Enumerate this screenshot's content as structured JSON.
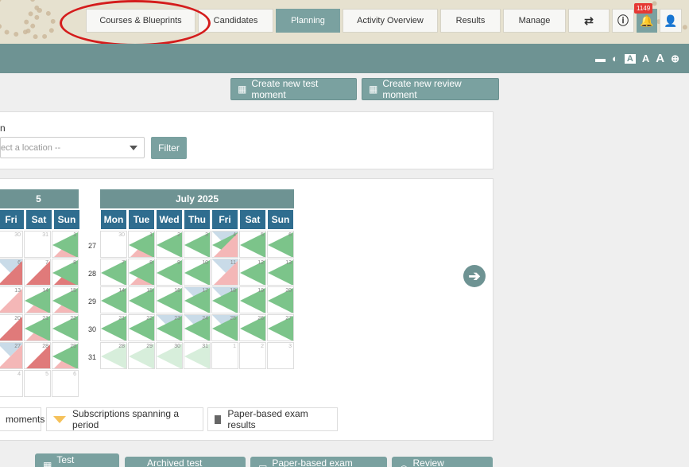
{
  "nav": {
    "tabs": [
      {
        "label": "Courses & Blueprints"
      },
      {
        "label": "Candidates"
      },
      {
        "label": "Planning"
      },
      {
        "label": "Activity Overview"
      },
      {
        "label": "Results"
      },
      {
        "label": "Manage"
      }
    ],
    "notification_count": "1149"
  },
  "toolbar": {
    "create_test_label": "Create new test moment",
    "create_review_label": "Create new review moment"
  },
  "filter": {
    "location_label": "n",
    "location_placeholder": "ect a location --",
    "filter_label": "Filter"
  },
  "calendar_left": {
    "title": "5",
    "days": [
      "Fri",
      "Sat",
      "Sun"
    ],
    "leading": [
      [
        "30",
        "31",
        "1"
      ]
    ]
  },
  "calendar_right": {
    "title": "July 2025",
    "days": [
      "Mon",
      "Tue",
      "Wed",
      "Thu",
      "Fri",
      "Sat",
      "Sun"
    ],
    "weeks": [
      "27",
      "28",
      "29",
      "30",
      "31"
    ],
    "rows": [
      [
        "30",
        "1",
        "2",
        "3",
        "4",
        "5",
        "6"
      ],
      [
        "7",
        "8",
        "9",
        "10",
        "11",
        "12",
        "13"
      ],
      [
        "14",
        "15",
        "16",
        "17",
        "18",
        "19",
        "20"
      ],
      [
        "21",
        "22",
        "23",
        "24",
        "25",
        "26",
        "27"
      ],
      [
        "28",
        "29",
        "30",
        "31",
        "1",
        "2",
        "3"
      ]
    ]
  },
  "legend": {
    "moments_label": "moments",
    "spanning_label": "Subscriptions spanning a period",
    "paper_label": "Paper-based exam results"
  },
  "bottom_tabs": [
    {
      "label": "Test moments"
    },
    {
      "label": "Archived test moments"
    },
    {
      "label": "Paper-based exam results"
    },
    {
      "label": "Review moments"
    }
  ]
}
